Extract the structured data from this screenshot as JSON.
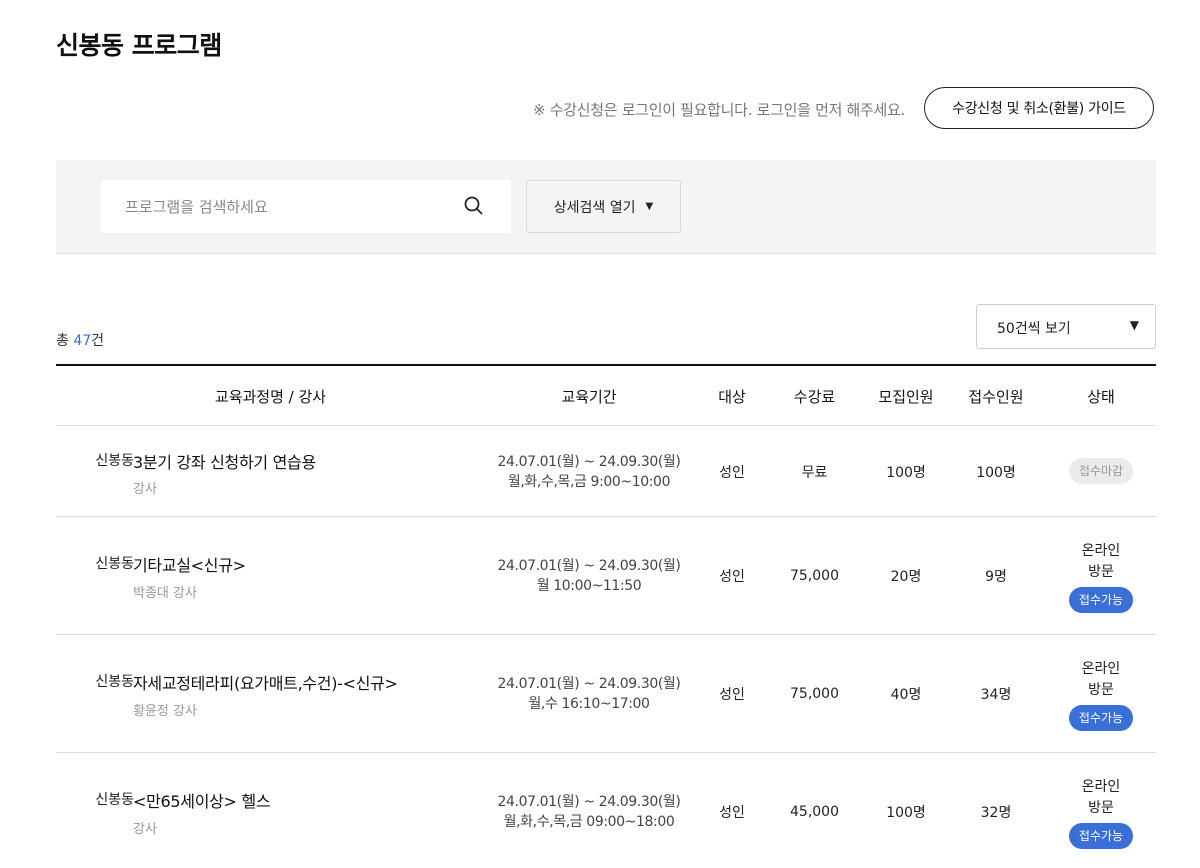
{
  "page": {
    "title": "신봉동 프로그램",
    "notice": "※ 수강신청은 로그인이 필요합니다. 로그인을 먼저 해주세요.",
    "guide_button": "수강신청 및 취소(환불) 가이드"
  },
  "search": {
    "placeholder": "프로그램을 검색하세요",
    "value": "",
    "detail_button": "상세검색 열기"
  },
  "summary": {
    "total_prefix": "총 ",
    "total_count": "47",
    "total_suffix": "건",
    "per_page": "50건씩 보기"
  },
  "table": {
    "headers": [
      "교육과정명 / 강사",
      "교육기간",
      "대상",
      "수강료",
      "모집인원",
      "접수인원",
      "상태"
    ],
    "rows": [
      {
        "dong": "신봉동",
        "name": "3분기 강좌 신청하기 연습용",
        "teacher": "강사",
        "period_range": "24.07.01(월) ~ 24.09.30(월)",
        "period_time": "월,화,수,목,금 9:00~10:00",
        "target": "성인",
        "fee": "무료",
        "recruit": "100명",
        "applied": "100명",
        "status_lines": [],
        "badge": "접수마감",
        "badge_type": "closed"
      },
      {
        "dong": "신봉동",
        "name": "기타교실<신규>",
        "teacher": "박종대 강사",
        "period_range": "24.07.01(월) ~ 24.09.30(월)",
        "period_time": "월 10:00~11:50",
        "target": "성인",
        "fee": "75,000",
        "recruit": "20명",
        "applied": "9명",
        "status_lines": [
          "온라인",
          "방문"
        ],
        "badge": "접수가능",
        "badge_type": "open"
      },
      {
        "dong": "신봉동",
        "name": "자세교정테라피(요가매트,수건)-<신규>",
        "teacher": "황윤정 강사",
        "period_range": "24.07.01(월) ~ 24.09.30(월)",
        "period_time": "월,수 16:10~17:00",
        "target": "성인",
        "fee": "75,000",
        "recruit": "40명",
        "applied": "34명",
        "status_lines": [
          "온라인",
          "방문"
        ],
        "badge": "접수가능",
        "badge_type": "open"
      },
      {
        "dong": "신봉동",
        "name": "<만65세이상> 헬스",
        "teacher": "강사",
        "period_range": "24.07.01(월) ~ 24.09.30(월)",
        "period_time": "월,화,수,목,금 09:00~18:00",
        "target": "성인",
        "fee": "45,000",
        "recruit": "100명",
        "applied": "32명",
        "status_lines": [
          "온라인",
          "방문"
        ],
        "badge": "접수가능",
        "badge_type": "open"
      }
    ]
  },
  "icons": {
    "search": "search-icon",
    "detail_arrow": "caret-down-icon",
    "per_page_arrow": "caret-down-icon"
  },
  "colors": {
    "accent": "#3a6fd8",
    "closed_badge_bg": "#ebebeb",
    "search_area_bg": "#f4f4f4"
  }
}
